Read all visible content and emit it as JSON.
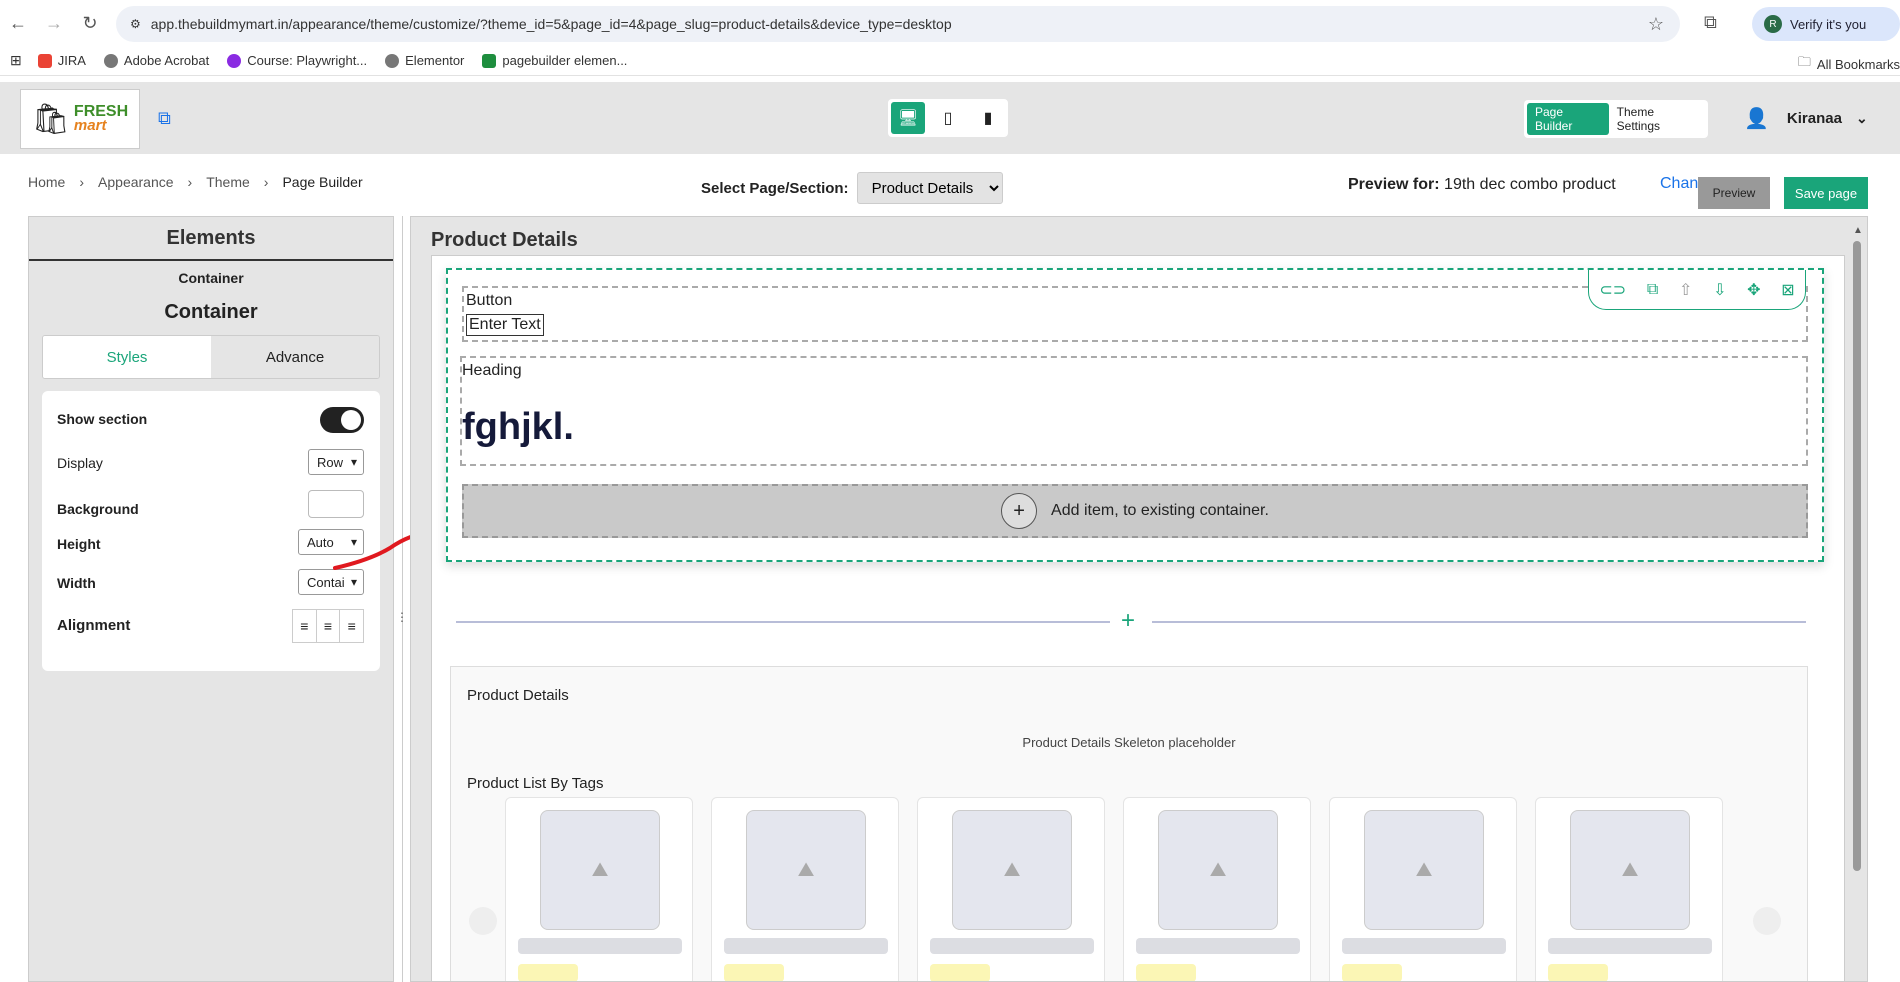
{
  "browser": {
    "url": "app.thebuildmymart.in/appearance/theme/customize/?theme_id=5&page_id=4&page_slug=product-details&device_type=desktop",
    "profile_label": "Verify it's you",
    "bookmarks": [
      "JIRA",
      "Adobe Acrobat",
      "Course: Playwright...",
      "Elementor",
      "pagebuilder elemen..."
    ],
    "all_bookmarks": "All Bookmarks"
  },
  "header": {
    "logo_line1": "FRESH",
    "logo_line2": "mart",
    "mode_page_builder": "Page Builder",
    "mode_theme_settings": "Theme Settings",
    "user_name": "Kiranaa"
  },
  "breadcrumb": {
    "items": [
      "Home",
      "Appearance",
      "Theme",
      "Page Builder"
    ]
  },
  "topbar": {
    "select_label": "Select Page/Section:",
    "select_value": "Product Details",
    "preview_for_label": "Preview for:",
    "preview_for_value": "19th dec combo product",
    "change_link": "Change",
    "preview_button": "Preview",
    "save_button": "Save page"
  },
  "left_panel": {
    "title": "Elements",
    "subtitle": "Container",
    "heading": "Container",
    "tabs": [
      "Styles",
      "Advance"
    ],
    "props": {
      "show_section": "Show section",
      "display": "Display",
      "display_value": "Row",
      "background": "Background",
      "height": "Height",
      "height_value": "Auto",
      "width": "Width",
      "width_value": "Contai",
      "alignment": "Alignment"
    }
  },
  "canvas": {
    "title": "Product Details",
    "button_label": "Button",
    "button_text": "Enter Text",
    "heading_label": "Heading",
    "heading_text": "fghjkl.",
    "add_item": "Add item, to existing container.",
    "pd_title": "Product Details",
    "pd_skeleton": "Product Details Skeleton placeholder",
    "pl_title": "Product List By Tags"
  },
  "colors": {
    "accent": "#1aa57a",
    "link": "#1a73e8"
  }
}
